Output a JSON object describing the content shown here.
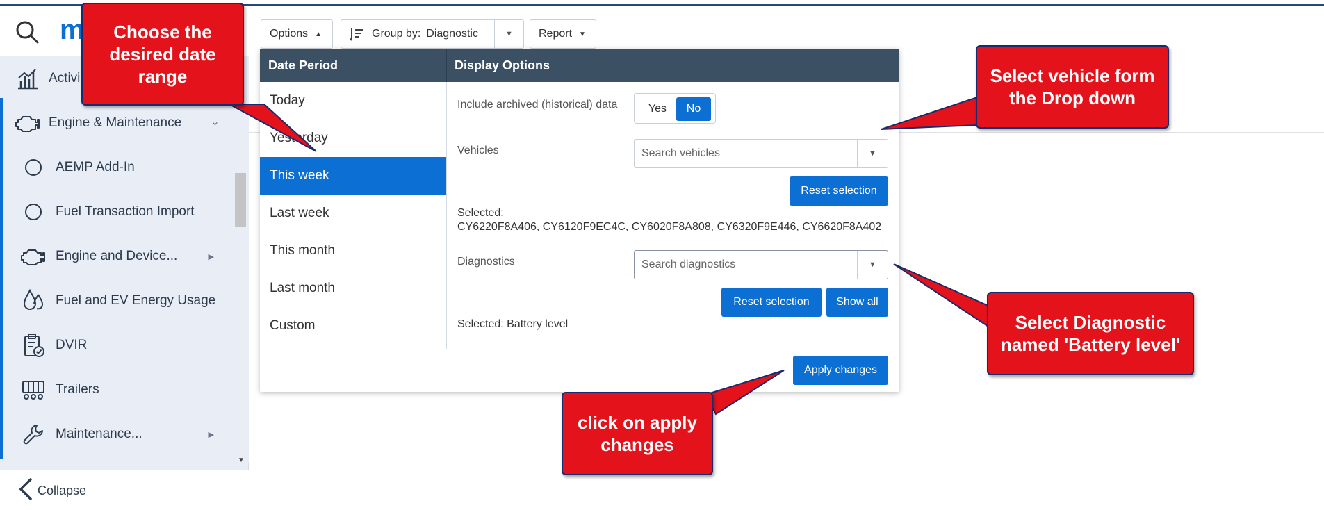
{
  "sidebar": {
    "logo": "m",
    "items": [
      {
        "label": "Activi",
        "icon": "bar-chart-icon"
      },
      {
        "label": "Engine & Maintenance",
        "icon": "engine-icon"
      },
      {
        "label": "AEMP Add-In",
        "icon": "circle-icon"
      },
      {
        "label": "Fuel Transaction Import",
        "icon": "circle-icon"
      },
      {
        "label": "Engine and Device...",
        "icon": "engine-icon"
      },
      {
        "label": "Fuel and EV Energy Usage",
        "icon": "fuel-drop-icon"
      },
      {
        "label": "DVIR",
        "icon": "clipboard-check-icon"
      },
      {
        "label": "Trailers",
        "icon": "trailer-icon"
      },
      {
        "label": "Maintenance...",
        "icon": "wrench-icon"
      }
    ],
    "collapse_label": "Collapse"
  },
  "toolbar": {
    "options_label": "Options",
    "group_by_label": "Group by:",
    "group_by_value": "Diagnostic",
    "report_label": "Report"
  },
  "panel": {
    "date_period_header": "Date Period",
    "display_options_header": "Display Options",
    "periods": [
      "Today",
      "Yesterday",
      "This week",
      "Last week",
      "This month",
      "Last month",
      "Custom"
    ],
    "selected_period": "This week",
    "archived_label": "Include archived (historical) data",
    "toggle_yes": "Yes",
    "toggle_no": "No",
    "vehicles_label": "Vehicles",
    "vehicles_placeholder": "Search vehicles",
    "reset_selection": "Reset selection",
    "vehicles_selected_label": "Selected:",
    "vehicles_selected": "CY6220F8A406, CY6120F9EC4C, CY6020F8A808, CY6320F9E446, CY6620F8A402",
    "diagnostics_label": "Diagnostics",
    "diagnostics_placeholder": "Search diagnostics",
    "reset_selection_2": "Reset selection",
    "show_all": "Show all",
    "diagnostics_selected": "Selected: Battery level",
    "apply_changes": "Apply changes"
  },
  "callouts": {
    "date_range": "Choose the desired date range",
    "vehicle": "Select vehicle form the Drop down",
    "diagnostic": "Select Diagnostic named 'Battery level'",
    "apply": "click on apply changes"
  },
  "colors": {
    "accent": "#0b6fd4",
    "panel_header": "#3c5064",
    "callout_red": "#e3121b",
    "callout_border": "#1b2a6b"
  }
}
